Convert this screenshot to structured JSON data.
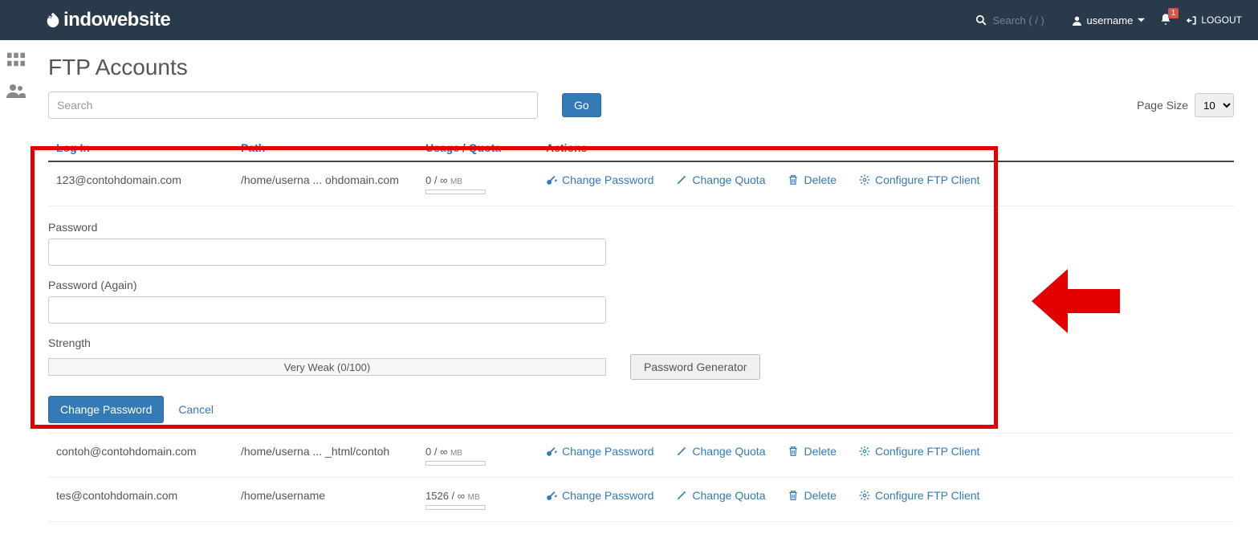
{
  "header": {
    "brand": "indowebsite",
    "search_placeholder": "Search ( / )",
    "username": "username",
    "notification_count": "1",
    "logout": "LOGOUT"
  },
  "page": {
    "title": "FTP Accounts",
    "search_placeholder": "Search",
    "go": "Go",
    "page_size_label": "Page Size",
    "page_size_value": "10"
  },
  "columns": {
    "login": "Log In",
    "path": "Path",
    "usage": "Usage",
    "quota": "Quota",
    "actions": "Actions"
  },
  "action_labels": {
    "change_password": "Change Password",
    "change_quota": "Change Quota",
    "delete": "Delete",
    "configure": "Configure FTP Client"
  },
  "accounts": [
    {
      "login": "123@contohdomain.com",
      "path": "/home/userna ... ohdomain.com",
      "usage": "0 / ∞",
      "unit": "MB"
    },
    {
      "login": "contoh@contohdomain.com",
      "path": "/home/userna ... _html/contoh",
      "usage": "0 / ∞",
      "unit": "MB"
    },
    {
      "login": "tes@contohdomain.com",
      "path": "/home/username",
      "usage": "1526 / ∞",
      "unit": "MB"
    }
  ],
  "password_panel": {
    "password_label": "Password",
    "password_again_label": "Password (Again)",
    "strength_label": "Strength",
    "strength_value": "Very Weak (0/100)",
    "generator": "Password Generator",
    "submit": "Change Password",
    "cancel": "Cancel"
  }
}
